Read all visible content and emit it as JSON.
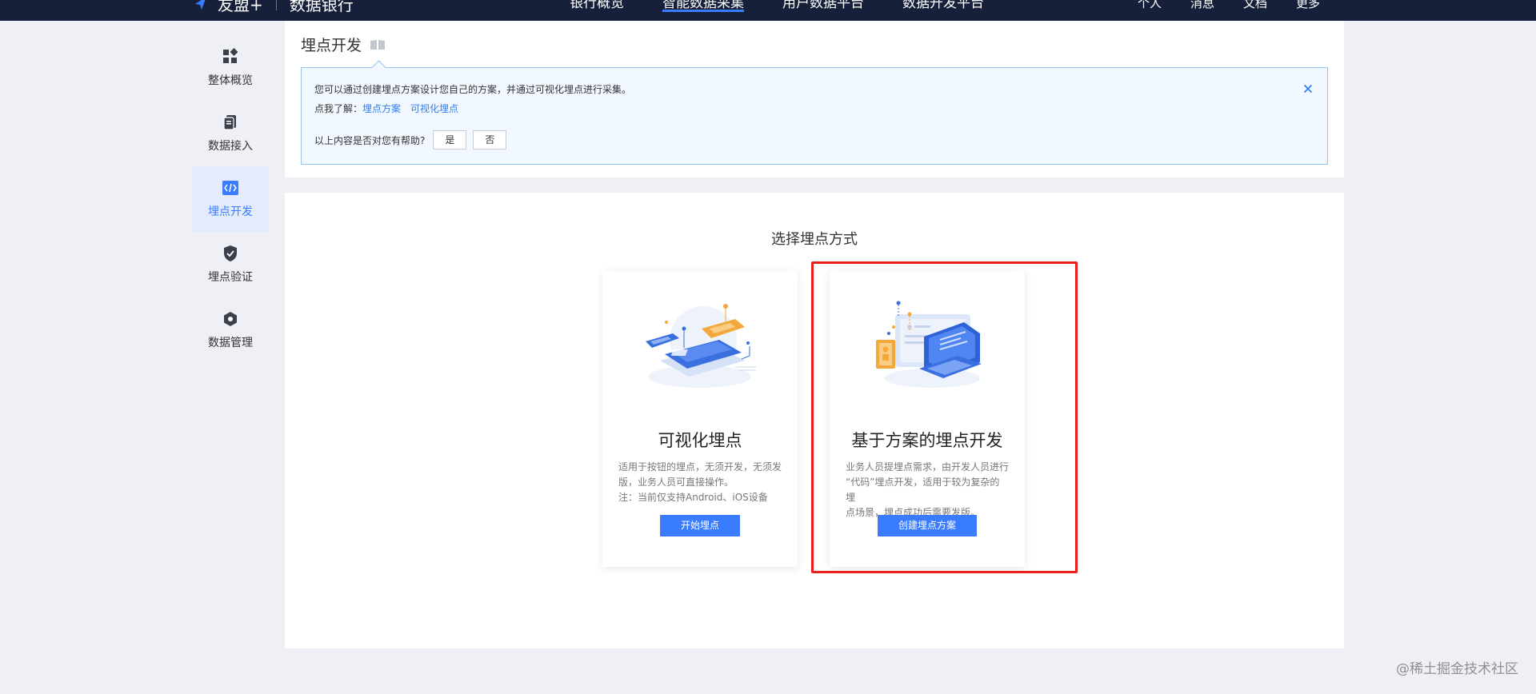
{
  "topbar": {
    "brand_name": "友盟+",
    "product": "数据银行",
    "nav": [
      {
        "label": "银行概览"
      },
      {
        "label": "智能数据采集"
      },
      {
        "label": "用户数据平台"
      },
      {
        "label": "数据开发平台"
      }
    ],
    "right": [
      "个人",
      "消息",
      "文档",
      "更多"
    ]
  },
  "sidemenu": {
    "items": [
      {
        "label": "整体概览",
        "icon": "dashboard-icon"
      },
      {
        "label": "数据接入",
        "icon": "document-icon"
      },
      {
        "label": "埋点开发",
        "icon": "code-icon"
      },
      {
        "label": "埋点验证",
        "icon": "shield-check-icon"
      },
      {
        "label": "数据管理",
        "icon": "hexagon-icon"
      }
    ]
  },
  "header": {
    "title": "埋点开发",
    "tip": {
      "line1": "您可以通过创建埋点方案设计您自己的方案，并通过可视化埋点进行采集。",
      "learn_prefix": "点我了解：",
      "link1": "埋点方案",
      "link2": "可视化埋点",
      "feedback_question": "以上内容是否对您有帮助?",
      "yes": "是",
      "no": "否"
    }
  },
  "main": {
    "section_title": "选择埋点方式",
    "options": [
      {
        "title": "可视化埋点",
        "desc_lines": [
          "适用于按钮的埋点，无须开发，无须发",
          "版，业务人员可直接操作。",
          "注：当前仅支持Android、iOS设备"
        ],
        "button": "开始埋点"
      },
      {
        "title": "基于方案的埋点开发",
        "desc_lines": [
          "业务人员提埋点需求，由开发人员进行",
          "“代码”埋点开发，适用于较为复杂的埋",
          "点场景，埋点成功后需要发版。"
        ],
        "button": "创建埋点方案"
      }
    ]
  },
  "watermark": "@稀土掘金技术社区",
  "colors": {
    "primary": "#3a7cff",
    "topbar_bg": "#17203a",
    "highlight": "#e8201b",
    "tip_bg": "#f1f8ff",
    "tip_border": "#93c5f2"
  }
}
